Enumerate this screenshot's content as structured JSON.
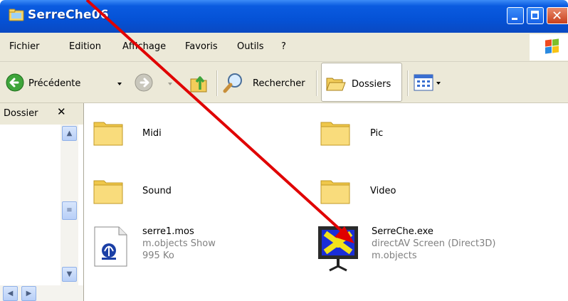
{
  "window": {
    "title": "SerreChe06",
    "minimize_icon": "minimize-icon",
    "maximize_icon": "maximize-icon",
    "close_icon": "close-icon"
  },
  "menu": {
    "items": [
      "Fichier",
      "Edition",
      "Affichage",
      "Favoris",
      "Outils",
      "?"
    ]
  },
  "toolbar": {
    "back_label": "Précédente",
    "search_label": "Rechercher",
    "folders_label": "Dossiers"
  },
  "folder_pane": {
    "title": "Dossier",
    "close_glyph": "✕"
  },
  "files": [
    {
      "name": "Midi",
      "type": "folder"
    },
    {
      "name": "Pic",
      "type": "folder"
    },
    {
      "name": "Sound",
      "type": "folder"
    },
    {
      "name": "Video",
      "type": "folder"
    },
    {
      "name": "serre1.mos",
      "line2": "m.objects Show",
      "line3": "995 Ko",
      "type": "file"
    },
    {
      "name": "SerreChe.exe",
      "line2": "directAV Screen (Direct3D)",
      "line3": "m.objects",
      "type": "exe"
    }
  ],
  "colors": {
    "titlebar": "#0552d6",
    "chrome": "#ece9d8",
    "annotation_arrow": "#e00000"
  }
}
